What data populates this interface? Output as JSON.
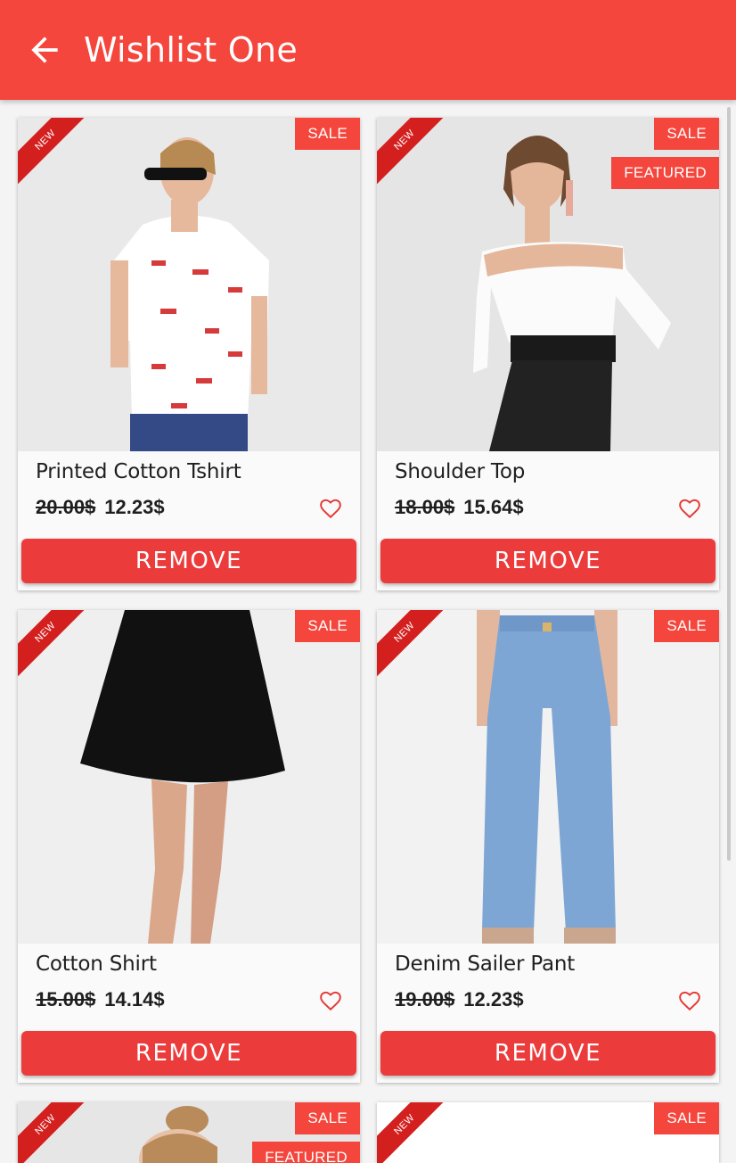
{
  "appbar": {
    "title": "Wishlist One",
    "back_icon": "arrow-left-icon"
  },
  "colors": {
    "accent": "#f4463c",
    "ribbon": "#d41f1f",
    "button": "#ec3b3b"
  },
  "products": [
    {
      "name": "Printed Cotton Tshirt",
      "old_price": "20.00$",
      "price": "12.23$",
      "ribbon": "NEW",
      "sale": "SALE",
      "featured": "",
      "button": "REMOVE"
    },
    {
      "name": "Shoulder Top",
      "old_price": "18.00$",
      "price": "15.64$",
      "ribbon": "NEW",
      "sale": "SALE",
      "featured": "FEATURED",
      "button": "REMOVE"
    },
    {
      "name": "Cotton Shirt",
      "old_price": "15.00$",
      "price": "14.14$",
      "ribbon": "NEW",
      "sale": "SALE",
      "featured": "",
      "button": "REMOVE"
    },
    {
      "name": "Denim Sailer Pant",
      "old_price": "19.00$",
      "price": "12.23$",
      "ribbon": "NEW",
      "sale": "SALE",
      "featured": "",
      "button": "REMOVE"
    },
    {
      "ribbon": "NEW",
      "sale": "SALE",
      "featured": "FEATURED"
    },
    {
      "ribbon": "NEW",
      "sale": "SALE",
      "featured": ""
    }
  ]
}
